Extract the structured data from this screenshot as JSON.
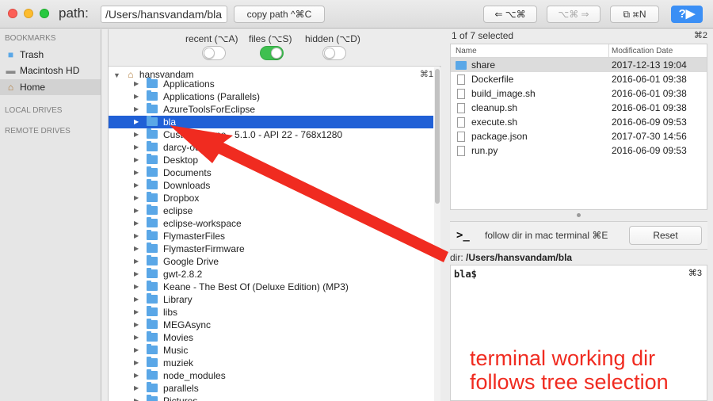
{
  "toolbar": {
    "path_label": "path:",
    "path_value": "/Users/hansvandam/bla",
    "copy_path_label": "copy path ^⌘C",
    "back_label": "⇐ ⌥⌘",
    "forward_label": "⌥⌘ ⇒",
    "new_window_label": "⧉ ⌘N",
    "help_label": "?▶"
  },
  "sidebar": {
    "bookmarks_header": "BOOKMARKS",
    "bookmarks": [
      {
        "label": "Trash",
        "icon": "folder-icon"
      },
      {
        "label": "Macintosh HD",
        "icon": "disk-icon"
      },
      {
        "label": "Home",
        "icon": "home-icon"
      }
    ],
    "local_drives_header": "LOCAL DRIVES",
    "remote_drives_header": "REMOTE DRIVES"
  },
  "filters": {
    "recent_label": "recent (⌥A)",
    "files_label": "files (⌥S)",
    "hidden_label": "hidden (⌥D)",
    "recent_on": false,
    "files_on": true,
    "hidden_on": false
  },
  "tree": {
    "root_label": "hansvandam",
    "root_shortcut": "⌘1",
    "items": [
      "Applications",
      "Applications (Parallels)",
      "AzureToolsForEclipse",
      "bla",
      "Custom Phone - 5.1.0 - API 22 - 768x1280",
      "darcy-out",
      "Desktop",
      "Documents",
      "Downloads",
      "Dropbox",
      "eclipse",
      "eclipse-workspace",
      "FlymasterFiles",
      "FlymasterFirmware",
      "Google Drive",
      "gwt-2.8.2",
      "Keane - The Best Of (Deluxe Edition) (MP3)",
      "Library",
      "libs",
      "MEGAsync",
      "Movies",
      "Music",
      "muziek",
      "node_modules",
      "parallels",
      "Pictures"
    ],
    "selected": "bla"
  },
  "files": {
    "selection_text": "1 of 7 selected",
    "selection_shortcut": "⌘2",
    "col_name": "Name",
    "col_date": "Modification Date",
    "rows": [
      {
        "name": "share",
        "date": "2017-12-13  19:04",
        "kind": "folder"
      },
      {
        "name": "Dockerfile",
        "date": "2016-06-01  09:38",
        "kind": "file"
      },
      {
        "name": "build_image.sh",
        "date": "2016-06-01  09:38",
        "kind": "file"
      },
      {
        "name": "cleanup.sh",
        "date": "2016-06-01  09:38",
        "kind": "file"
      },
      {
        "name": "execute.sh",
        "date": "2016-06-09  09:53",
        "kind": "file"
      },
      {
        "name": "package.json",
        "date": "2017-07-30  14:56",
        "kind": "file"
      },
      {
        "name": "run.py",
        "date": "2016-06-09  09:53",
        "kind": "file"
      }
    ]
  },
  "terminal": {
    "prompt_icon": ">_",
    "follow_label": "follow dir in mac terminal ⌘E",
    "reset_label": "Reset",
    "dir_label": "dir:",
    "dir_value": "/Users/hansvandam/bla",
    "prompt_text": "bla$",
    "shortcut": "⌘3",
    "annotation": "terminal working dir follows tree selection"
  },
  "colors": {
    "selection_blue": "#2060d6",
    "toggle_green": "#3fc050",
    "annotation_red": "#f02b20",
    "folder_blue": "#5aa7e7"
  }
}
